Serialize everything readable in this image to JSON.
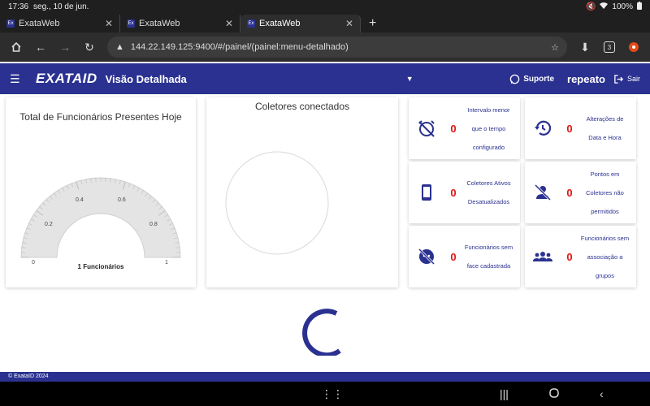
{
  "status": {
    "time": "17:36",
    "date": "seg., 10 de jun.",
    "battery": "100%"
  },
  "tabs": [
    {
      "label": "ExataWeb"
    },
    {
      "label": "ExataWeb"
    },
    {
      "label": "ExataWeb"
    }
  ],
  "browser": {
    "url": "144.22.149.125:9400/#/painel/(painel:menu-detalhado)",
    "tab_count": "3"
  },
  "appbar": {
    "logo": "EXATAID",
    "title": "Visão Detalhada",
    "support": "Suporte",
    "user": "repeato",
    "logout": "Sair"
  },
  "gauge": {
    "title": "Total de Funcionários Presentes Hoje",
    "value": 1,
    "range": [
      0,
      1
    ],
    "ticks": [
      "0",
      "0.2",
      "0.4",
      "0.6",
      "0.8",
      "1"
    ],
    "caption": "1 Funcionários"
  },
  "collectors": {
    "title": "Coletores conectados"
  },
  "stats": [
    {
      "icon": "alarm-off-icon",
      "value": "0",
      "label": "Intervalo menor que o tempo configurado"
    },
    {
      "icon": "history-icon",
      "value": "0",
      "label": "Alterações de Data e Hora"
    },
    {
      "icon": "tablet-icon",
      "value": "0",
      "label": "Coletores Ativos Desatualizados"
    },
    {
      "icon": "person-off-icon",
      "value": "0",
      "label": "Pontos em Coletores não permitidos"
    },
    {
      "icon": "face-off-icon",
      "value": "0",
      "label": "Funcionários sem face cadastrada"
    },
    {
      "icon": "groups-icon",
      "value": "0",
      "label": "Funcionários sem associação a grupos"
    }
  ],
  "footer": {
    "copyright": "© ExataID 2024"
  },
  "colors": {
    "primary": "#2a3190",
    "alert": "#e01414"
  }
}
